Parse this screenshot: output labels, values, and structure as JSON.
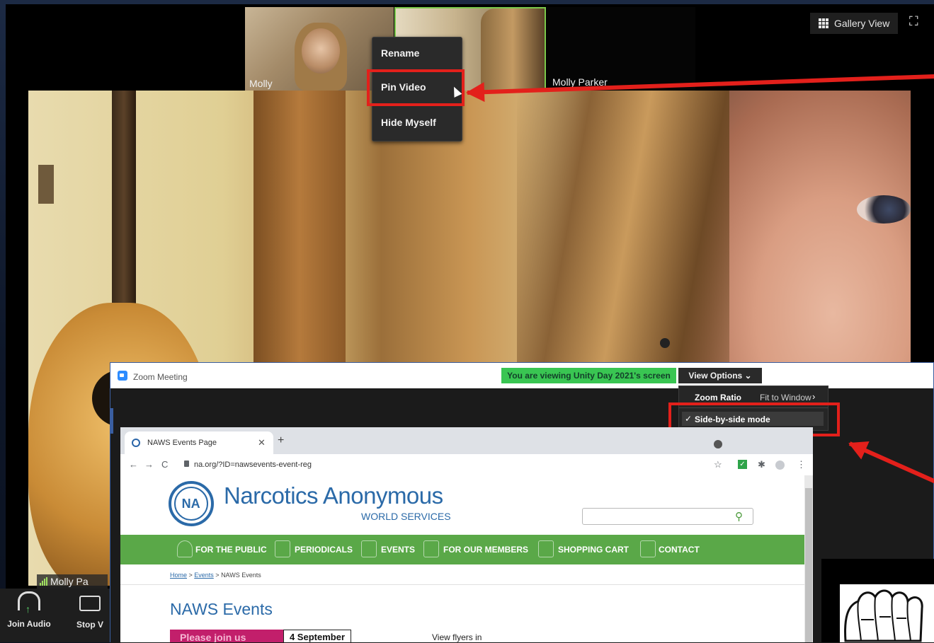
{
  "gallery": {
    "participants": [
      {
        "name": "Molly"
      },
      {
        "name": ""
      },
      {
        "name": "Molly Parker"
      }
    ],
    "gallery_view_label": "Gallery View",
    "fullscreen_icon": "fullscreen-icon"
  },
  "context_menu": {
    "items": [
      "Rename",
      "Pin Video",
      "Hide Myself"
    ],
    "highlighted": "Pin Video"
  },
  "speaker": {
    "name": "Molly Pa"
  },
  "toolbar": {
    "join_audio": "Join Audio",
    "stop_video": "Stop V"
  },
  "share_window": {
    "title": "Zoom Meeting",
    "viewing_banner": "You are viewing Unity Day 2021's screen",
    "view_options": "View Options ⌄",
    "view_menu": {
      "zoom_ratio_label": "Zoom Ratio",
      "zoom_ratio_value": "Fit to Window",
      "side_by_side": "Side-by-side mode",
      "side_by_side_checked": true
    }
  },
  "browser": {
    "tab_title": "NAWS Events Page",
    "url": "na.org/?ID=nawsevents-event-reg",
    "site": {
      "logo_text": "NA",
      "name": "Narcotics Anonymous",
      "subtitle": "WORLD SERVICES",
      "nav": [
        "FOR THE PUBLIC",
        "PERIODICALS",
        "EVENTS",
        "FOR OUR MEMBERS",
        "SHOPPING CART",
        "CONTACT"
      ],
      "breadcrumb": {
        "home": "Home",
        "sep": " > ",
        "events": "Events",
        "current": "NAWS Events"
      },
      "heading": "NAWS Events",
      "promo_text": "Please join us",
      "promo_date": "4 September",
      "flyers_text": "View flyers in"
    }
  },
  "colors": {
    "annotation_red": "#e3201b",
    "zoom_green": "#39c552",
    "na_blue": "#2b6aa8",
    "na_green": "#5aa848"
  }
}
